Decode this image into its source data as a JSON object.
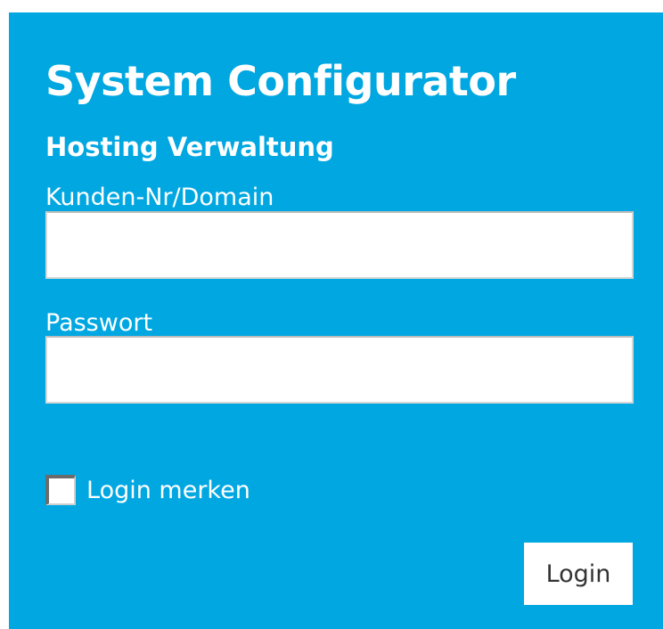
{
  "header": {
    "title": "System Configurator",
    "subtitle": "Hosting Verwaltung"
  },
  "form": {
    "username_label": "Kunden-Nr/Domain",
    "username_value": "",
    "password_label": "Passwort",
    "password_value": "",
    "remember_label": "Login merken",
    "remember_checked": false,
    "submit_label": "Login"
  },
  "colors": {
    "panel_background": "#00a7e1",
    "text": "#ffffff"
  }
}
